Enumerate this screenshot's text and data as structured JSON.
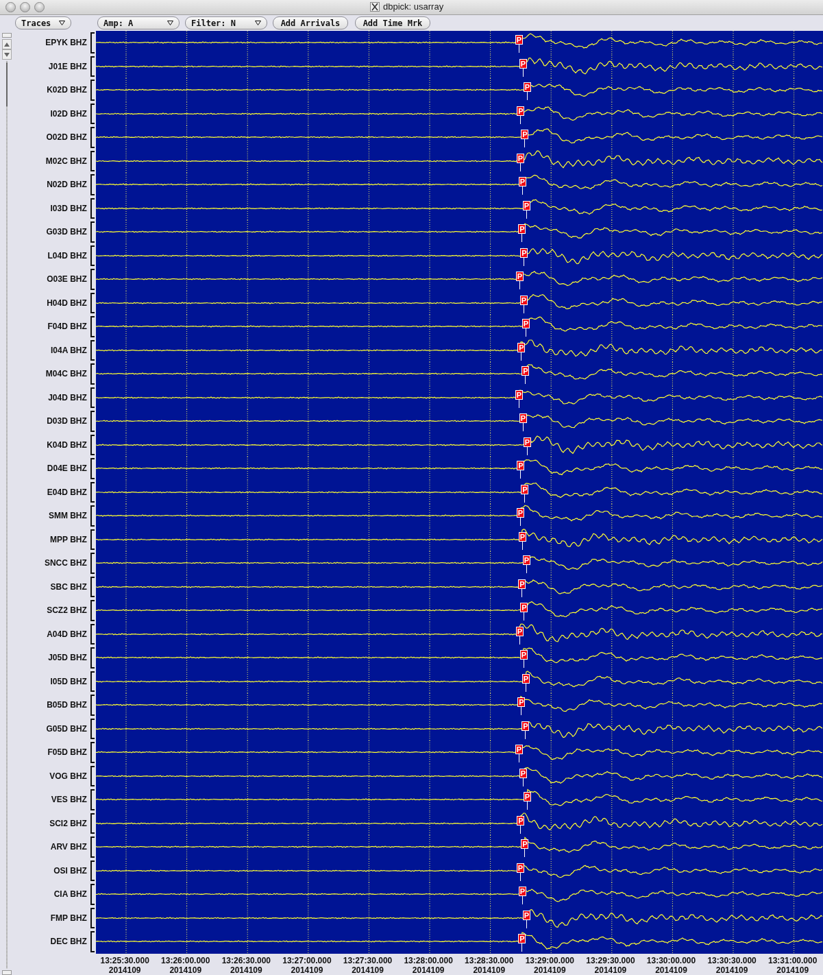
{
  "window": {
    "title": "dbpick: usarray"
  },
  "toolbar": [
    {
      "kind": "menu",
      "label": "Traces"
    },
    {
      "kind": "menu",
      "label": "Amp: A"
    },
    {
      "kind": "menu",
      "label": "Filter: N"
    },
    {
      "kind": "button",
      "label": "Add Arrivals"
    },
    {
      "kind": "button",
      "label": "Add Time Mrk"
    }
  ],
  "traces": [
    {
      "label": "EPYK BHZ",
      "phase": "P"
    },
    {
      "label": "J01E BHZ",
      "phase": "P"
    },
    {
      "label": "K02D BHZ",
      "phase": "P"
    },
    {
      "label": "I02D BHZ",
      "phase": "P"
    },
    {
      "label": "O02D BHZ",
      "phase": "P"
    },
    {
      "label": "M02C BHZ",
      "phase": "P"
    },
    {
      "label": "N02D BHZ",
      "phase": "P"
    },
    {
      "label": "I03D BHZ",
      "phase": "P"
    },
    {
      "label": "G03D BHZ",
      "phase": "P"
    },
    {
      "label": "L04D BHZ",
      "phase": "P"
    },
    {
      "label": "O03E BHZ",
      "phase": "P"
    },
    {
      "label": "H04D BHZ",
      "phase": "P"
    },
    {
      "label": "F04D BHZ",
      "phase": "P"
    },
    {
      "label": "I04A BHZ",
      "phase": "P"
    },
    {
      "label": "M04C BHZ",
      "phase": "P"
    },
    {
      "label": "J04D BHZ",
      "phase": "P"
    },
    {
      "label": "D03D BHZ",
      "phase": "P"
    },
    {
      "label": "K04D BHZ",
      "phase": "P"
    },
    {
      "label": "D04E BHZ",
      "phase": "P"
    },
    {
      "label": "E04D BHZ",
      "phase": "P"
    },
    {
      "label": "SMM BHZ",
      "phase": "P"
    },
    {
      "label": "MPP BHZ",
      "phase": "P"
    },
    {
      "label": "SNCC BHZ",
      "phase": "P"
    },
    {
      "label": "SBC BHZ",
      "phase": "P"
    },
    {
      "label": "SCZ2 BHZ",
      "phase": "P"
    },
    {
      "label": "A04D BHZ",
      "phase": "P"
    },
    {
      "label": "J05D BHZ",
      "phase": "P"
    },
    {
      "label": "I05D BHZ",
      "phase": "P"
    },
    {
      "label": "B05D BHZ",
      "phase": "P"
    },
    {
      "label": "G05D BHZ",
      "phase": "P"
    },
    {
      "label": "F05D BHZ",
      "phase": "P"
    },
    {
      "label": "VOG BHZ",
      "phase": "P"
    },
    {
      "label": "VES BHZ",
      "phase": "P"
    },
    {
      "label": "SCI2 BHZ",
      "phase": "P"
    },
    {
      "label": "ARV BHZ",
      "phase": "P"
    },
    {
      "label": "OSI BHZ",
      "phase": "P"
    },
    {
      "label": "CIA BHZ",
      "phase": "P"
    },
    {
      "label": "FMP BHZ",
      "phase": "P"
    },
    {
      "label": "DEC BHZ",
      "phase": "P"
    }
  ],
  "time_axis": [
    {
      "time": "13:25:30.000",
      "date": "2014109"
    },
    {
      "time": "13:26:00.000",
      "date": "2014109"
    },
    {
      "time": "13:26:30.000",
      "date": "2014109"
    },
    {
      "time": "13:27:00.000",
      "date": "2014109"
    },
    {
      "time": "13:27:30.000",
      "date": "2014109"
    },
    {
      "time": "13:28:00.000",
      "date": "2014109"
    },
    {
      "time": "13:28:30.000",
      "date": "2014109"
    },
    {
      "time": "13:29:00.000",
      "date": "2014109"
    },
    {
      "time": "13:29:30.000",
      "date": "2014109"
    },
    {
      "time": "13:30:00.000",
      "date": "2014109"
    },
    {
      "time": "13:30:30.000",
      "date": "2014109"
    },
    {
      "time": "13:31:00.000",
      "date": "2014109"
    }
  ]
}
